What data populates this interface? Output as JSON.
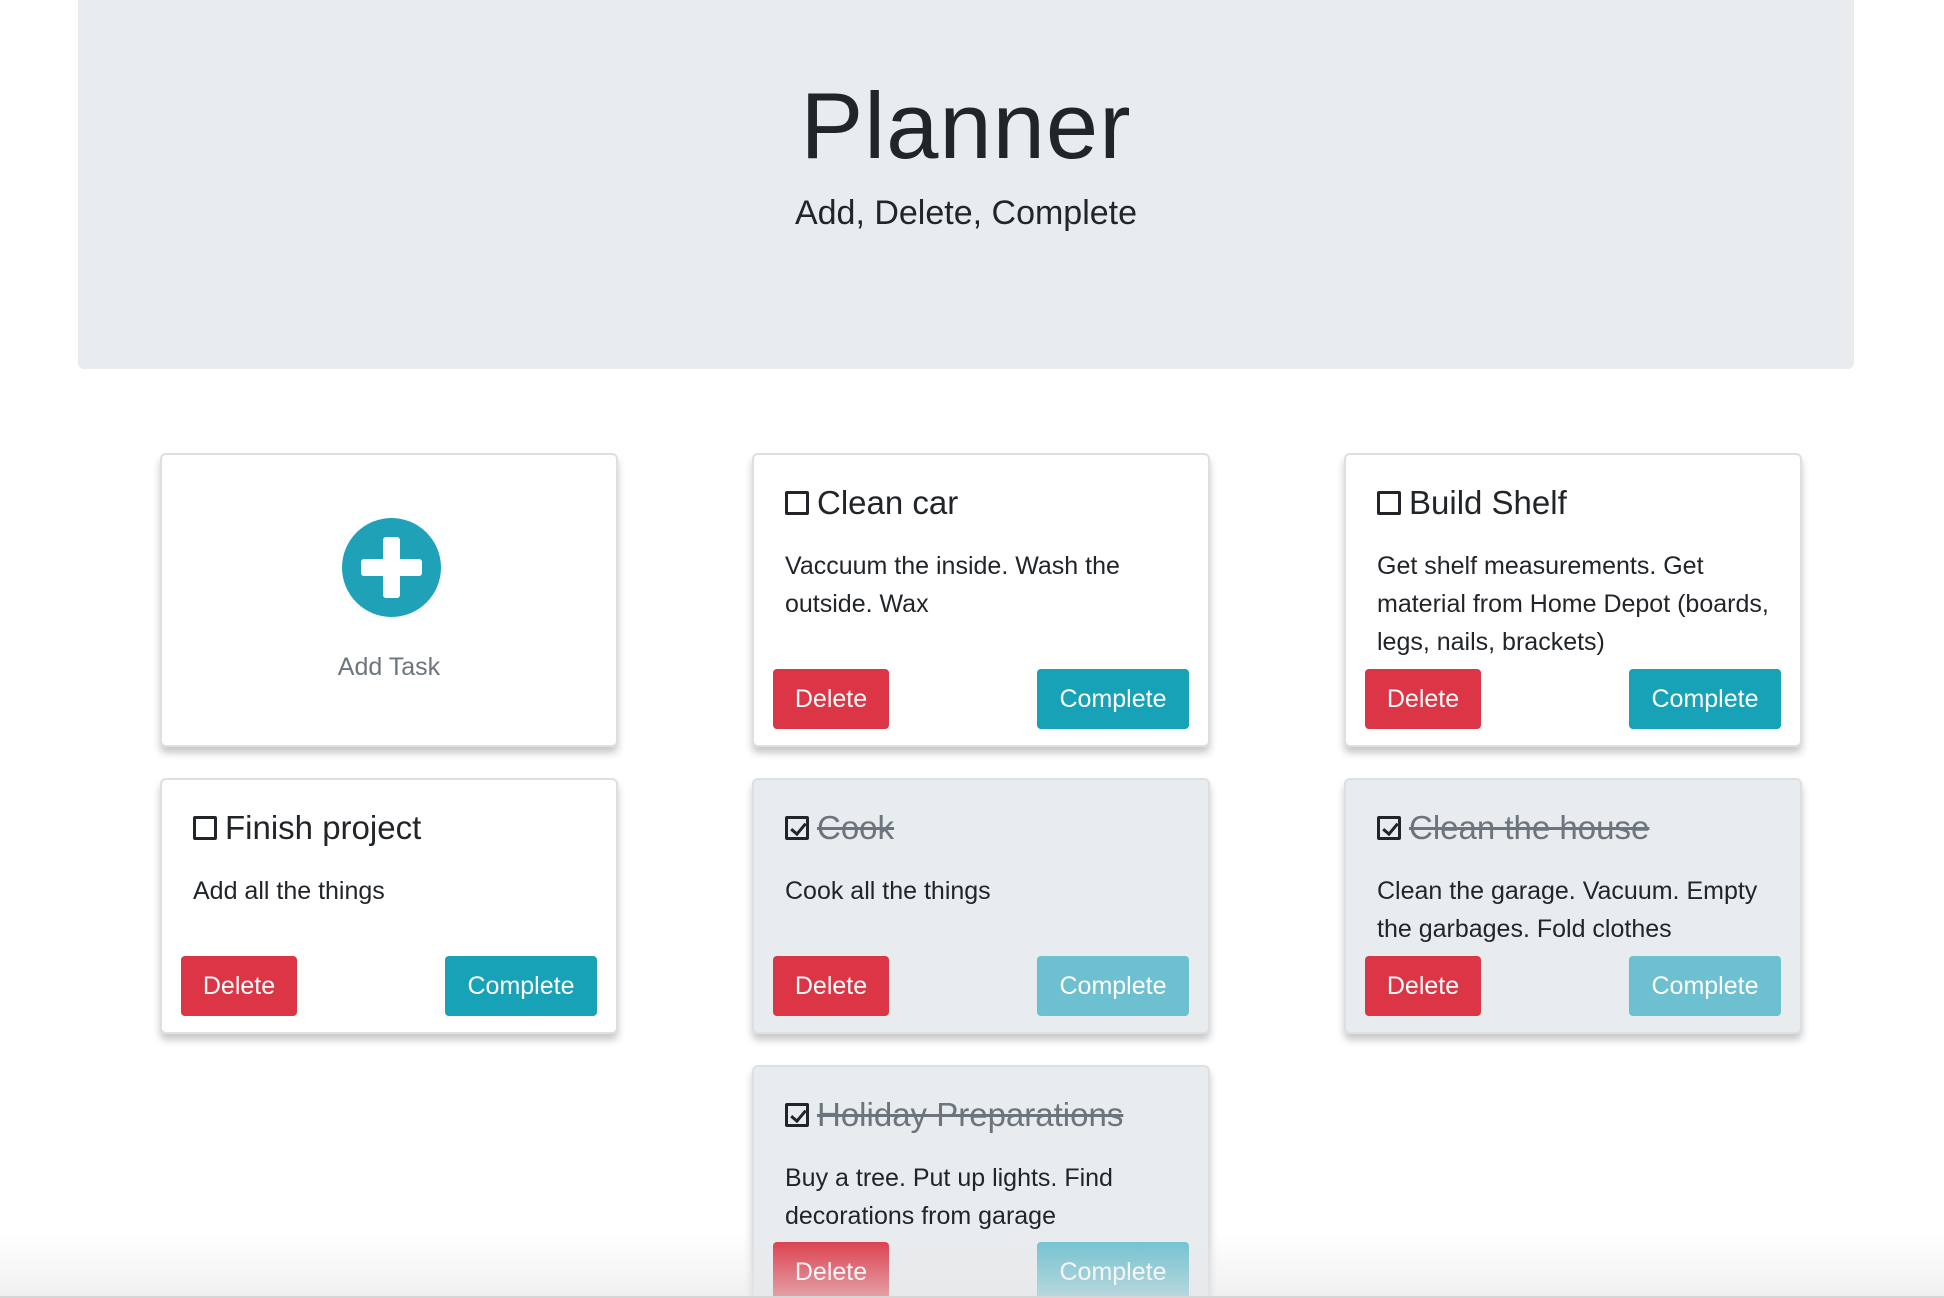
{
  "header": {
    "title": "Planner",
    "subtitle": "Add, Delete, Complete"
  },
  "add_task": {
    "icon": "plus-circle-icon",
    "label": "Add Task"
  },
  "tasks": [
    {
      "title": "Clean car",
      "description": "Vaccuum the inside. Wash the outside. Wax",
      "completed": false,
      "delete_label": "Delete",
      "complete_label": "Complete"
    },
    {
      "title": "Build Shelf",
      "description": "Get shelf measurements. Get material from Home Depot (boards, legs, nails, brackets)",
      "completed": false,
      "delete_label": "Delete",
      "complete_label": "Complete"
    },
    {
      "title": "Finish project",
      "description": "Add all the things",
      "completed": false,
      "delete_label": "Delete",
      "complete_label": "Complete"
    },
    {
      "title": "Cook",
      "description": "Cook all the things",
      "completed": true,
      "delete_label": "Delete",
      "complete_label": "Complete"
    },
    {
      "title": "Clean the house",
      "description": "Clean the garage. Vacuum. Empty the garbages. Fold clothes",
      "completed": true,
      "delete_label": "Delete",
      "complete_label": "Complete"
    },
    {
      "title": "Holiday Preparations",
      "description": "Buy a tree. Put up lights. Find decorations from garage",
      "completed": true,
      "delete_label": "Delete",
      "complete_label": "Complete"
    }
  ],
  "colors": {
    "jumbotron_bg": "#e9ecef",
    "delete": "#dc3545",
    "complete": "#17a2b8",
    "complete_disabled": "#6dc0cf",
    "add_icon": "#1fa2b7"
  }
}
